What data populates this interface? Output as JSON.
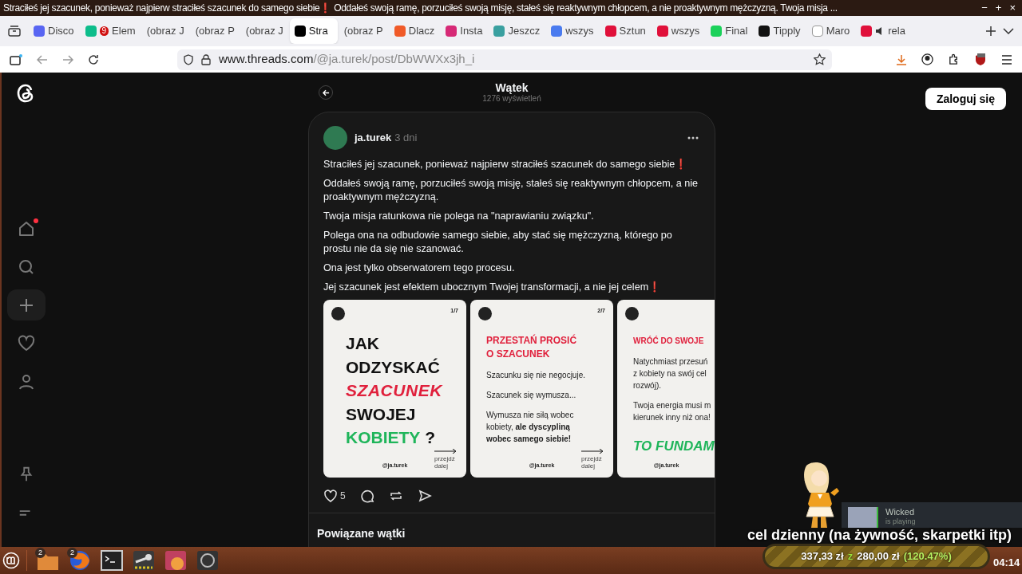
{
  "window": {
    "title": "Straciłeś jej szacunek, ponieważ najpierw straciłeś szacunek do samego siebie❗ Oddałeś swoją ramę, porzuciłeś swoją misję, stałeś się reaktywnym chłopcem, a nie proaktywnym mężczyzną. Twoja misja ...",
    "controls": [
      "−",
      "+",
      "×"
    ]
  },
  "tabs": [
    {
      "label": "Disco",
      "color": "#5865f2",
      "selected": false
    },
    {
      "label": "Elem",
      "color": "#0dbd8b",
      "badge": "9",
      "selected": false
    },
    {
      "label": "(obraz J",
      "selected": false
    },
    {
      "label": "(obraz P",
      "selected": false
    },
    {
      "label": "(obraz J",
      "selected": false
    },
    {
      "label": "Stra",
      "color": "#000000",
      "selected": true
    },
    {
      "label": "(obraz P",
      "selected": false
    },
    {
      "label": "Dlacz",
      "color": "#f05a28",
      "selected": false
    },
    {
      "label": "Insta",
      "color": "#d62976",
      "selected": false
    },
    {
      "label": "Jeszcz",
      "color": "#3aa0a0",
      "selected": false
    },
    {
      "label": "wszys",
      "color": "#4a7bef",
      "selected": false
    },
    {
      "label": "Sztun",
      "color": "#e0103a",
      "selected": false
    },
    {
      "label": "wszys",
      "color": "#e0103a",
      "selected": false
    },
    {
      "label": "Final",
      "color": "#1bd15a",
      "selected": false
    },
    {
      "label": "Tipply",
      "color": "#111111",
      "selected": false
    },
    {
      "label": "Maro",
      "color": "#ffffff",
      "selected": false
    },
    {
      "label": "rela",
      "color": "#e0103a",
      "audio": true,
      "selected": false
    }
  ],
  "address_bar": {
    "host": "www.threads.com",
    "path": "/@ja.turek/post/DbWWXx3jh_i"
  },
  "sidebar": {
    "items": [
      {
        "kind": "home",
        "notification": true,
        "selected": false
      },
      {
        "kind": "search",
        "selected": false
      },
      {
        "kind": "create",
        "selected": true
      },
      {
        "kind": "heart",
        "selected": false
      },
      {
        "kind": "profile",
        "selected": false
      }
    ],
    "bottom": [
      {
        "kind": "pin"
      },
      {
        "kind": "menu"
      }
    ]
  },
  "header": {
    "title": "Wątek",
    "views": "1276 wyświetleń"
  },
  "login_button": "Zaloguj się",
  "post": {
    "author": "ja.turek",
    "time": "3 dni",
    "paragraphs": [
      "Straciłeś jej szacunek, ponieważ najpierw straciłeś szacunek do samego siebie❗",
      "Oddałeś swoją ramę, porzuciłeś swoją misję, stałeś się reaktywnym chłopcem, a nie proaktywnym mężczyzną.",
      "Twoja misja ratunkowa nie polega na \"naprawianiu związku\".",
      "Polega ona na odbudowie samego siebie, aby stać się mężczyzną, którego po prostu nie da się nie szanować.",
      "Ona jest tylko obserwatorem tego procesu.",
      "Jej szacunek jest efektem ubocznym Twojej transformacji, a nie jej celem❗"
    ],
    "slides": [
      {
        "page": "1/7",
        "handle": "@ja.turek",
        "next": "przejdź dalej",
        "blocks": [
          {
            "kind": "headline",
            "parts": [
              {
                "text": "JAK",
                "color": "#111111"
              }
            ]
          },
          {
            "kind": "headline",
            "parts": [
              {
                "text": "ODZYSKAĆ",
                "color": "#111111"
              }
            ]
          },
          {
            "kind": "headline",
            "parts": [
              {
                "text": "SZACUNEK",
                "color": "#e0203c"
              }
            ]
          },
          {
            "kind": "headline",
            "parts": [
              {
                "text": "SWOJEJ",
                "color": "#111111"
              }
            ]
          },
          {
            "kind": "headline",
            "parts": [
              {
                "text": "KOBIETY",
                "color": "#1fb55a"
              },
              {
                "text": "?",
                "color": "#111111"
              }
            ]
          }
        ]
      },
      {
        "page": "2/7",
        "handle": "@ja.turek",
        "next": "przejdź dalej",
        "blocks": [
          {
            "kind": "title",
            "lines": [
              "PRZESTAŃ PROSIĆ",
              "O SZACUNEK"
            ]
          },
          {
            "kind": "text",
            "lines": [
              "Szacunku się nie negocjuje."
            ]
          },
          {
            "kind": "text",
            "lines": [
              "Szacunek się wymusza..."
            ]
          },
          {
            "kind": "text",
            "lines": [
              "Wymusza nie siłą wobec",
              "kobiety, **ale dyscypliną**",
              "**wobec samego siebie!**"
            ]
          }
        ]
      },
      {
        "handle": "@ja.turek",
        "blocks": [
          {
            "kind": "title",
            "lines": [
              "WRÓĆ DO SWOJE"
            ]
          },
          {
            "kind": "text",
            "lines": [
              "Natychmiast przesuń",
              "z kobiety na swój cel",
              "rozwój)."
            ]
          },
          {
            "kind": "text",
            "lines": [
              "Twoja energia musi m",
              "kierunek inny niż ona!"
            ]
          },
          {
            "kind": "accent",
            "lines": [
              "TO FUNDAM"
            ]
          }
        ]
      }
    ],
    "actions": [
      {
        "kind": "like",
        "count": "5"
      },
      {
        "kind": "comment"
      },
      {
        "kind": "repost"
      },
      {
        "kind": "share"
      }
    ]
  },
  "related_title": "Powiązane wątki",
  "stream_overlay": {
    "now_playing": {
      "title": "Wicked",
      "subtitle": "is playing"
    },
    "goal_label": "cel dzienny (na żywność, skarpetki itp)",
    "goal": {
      "current": "337,33 zł",
      "separator": "z",
      "target": "280,00 zł",
      "percent": "(120.47%)",
      "level": 1
    }
  },
  "taskbar": {
    "apps": [
      {
        "kind": "files",
        "badge": "2"
      },
      {
        "kind": "browser",
        "badge": "2"
      },
      {
        "kind": "terminal"
      },
      {
        "kind": "steam"
      },
      {
        "kind": "game"
      },
      {
        "kind": "disc"
      }
    ],
    "clock": "04:14"
  }
}
